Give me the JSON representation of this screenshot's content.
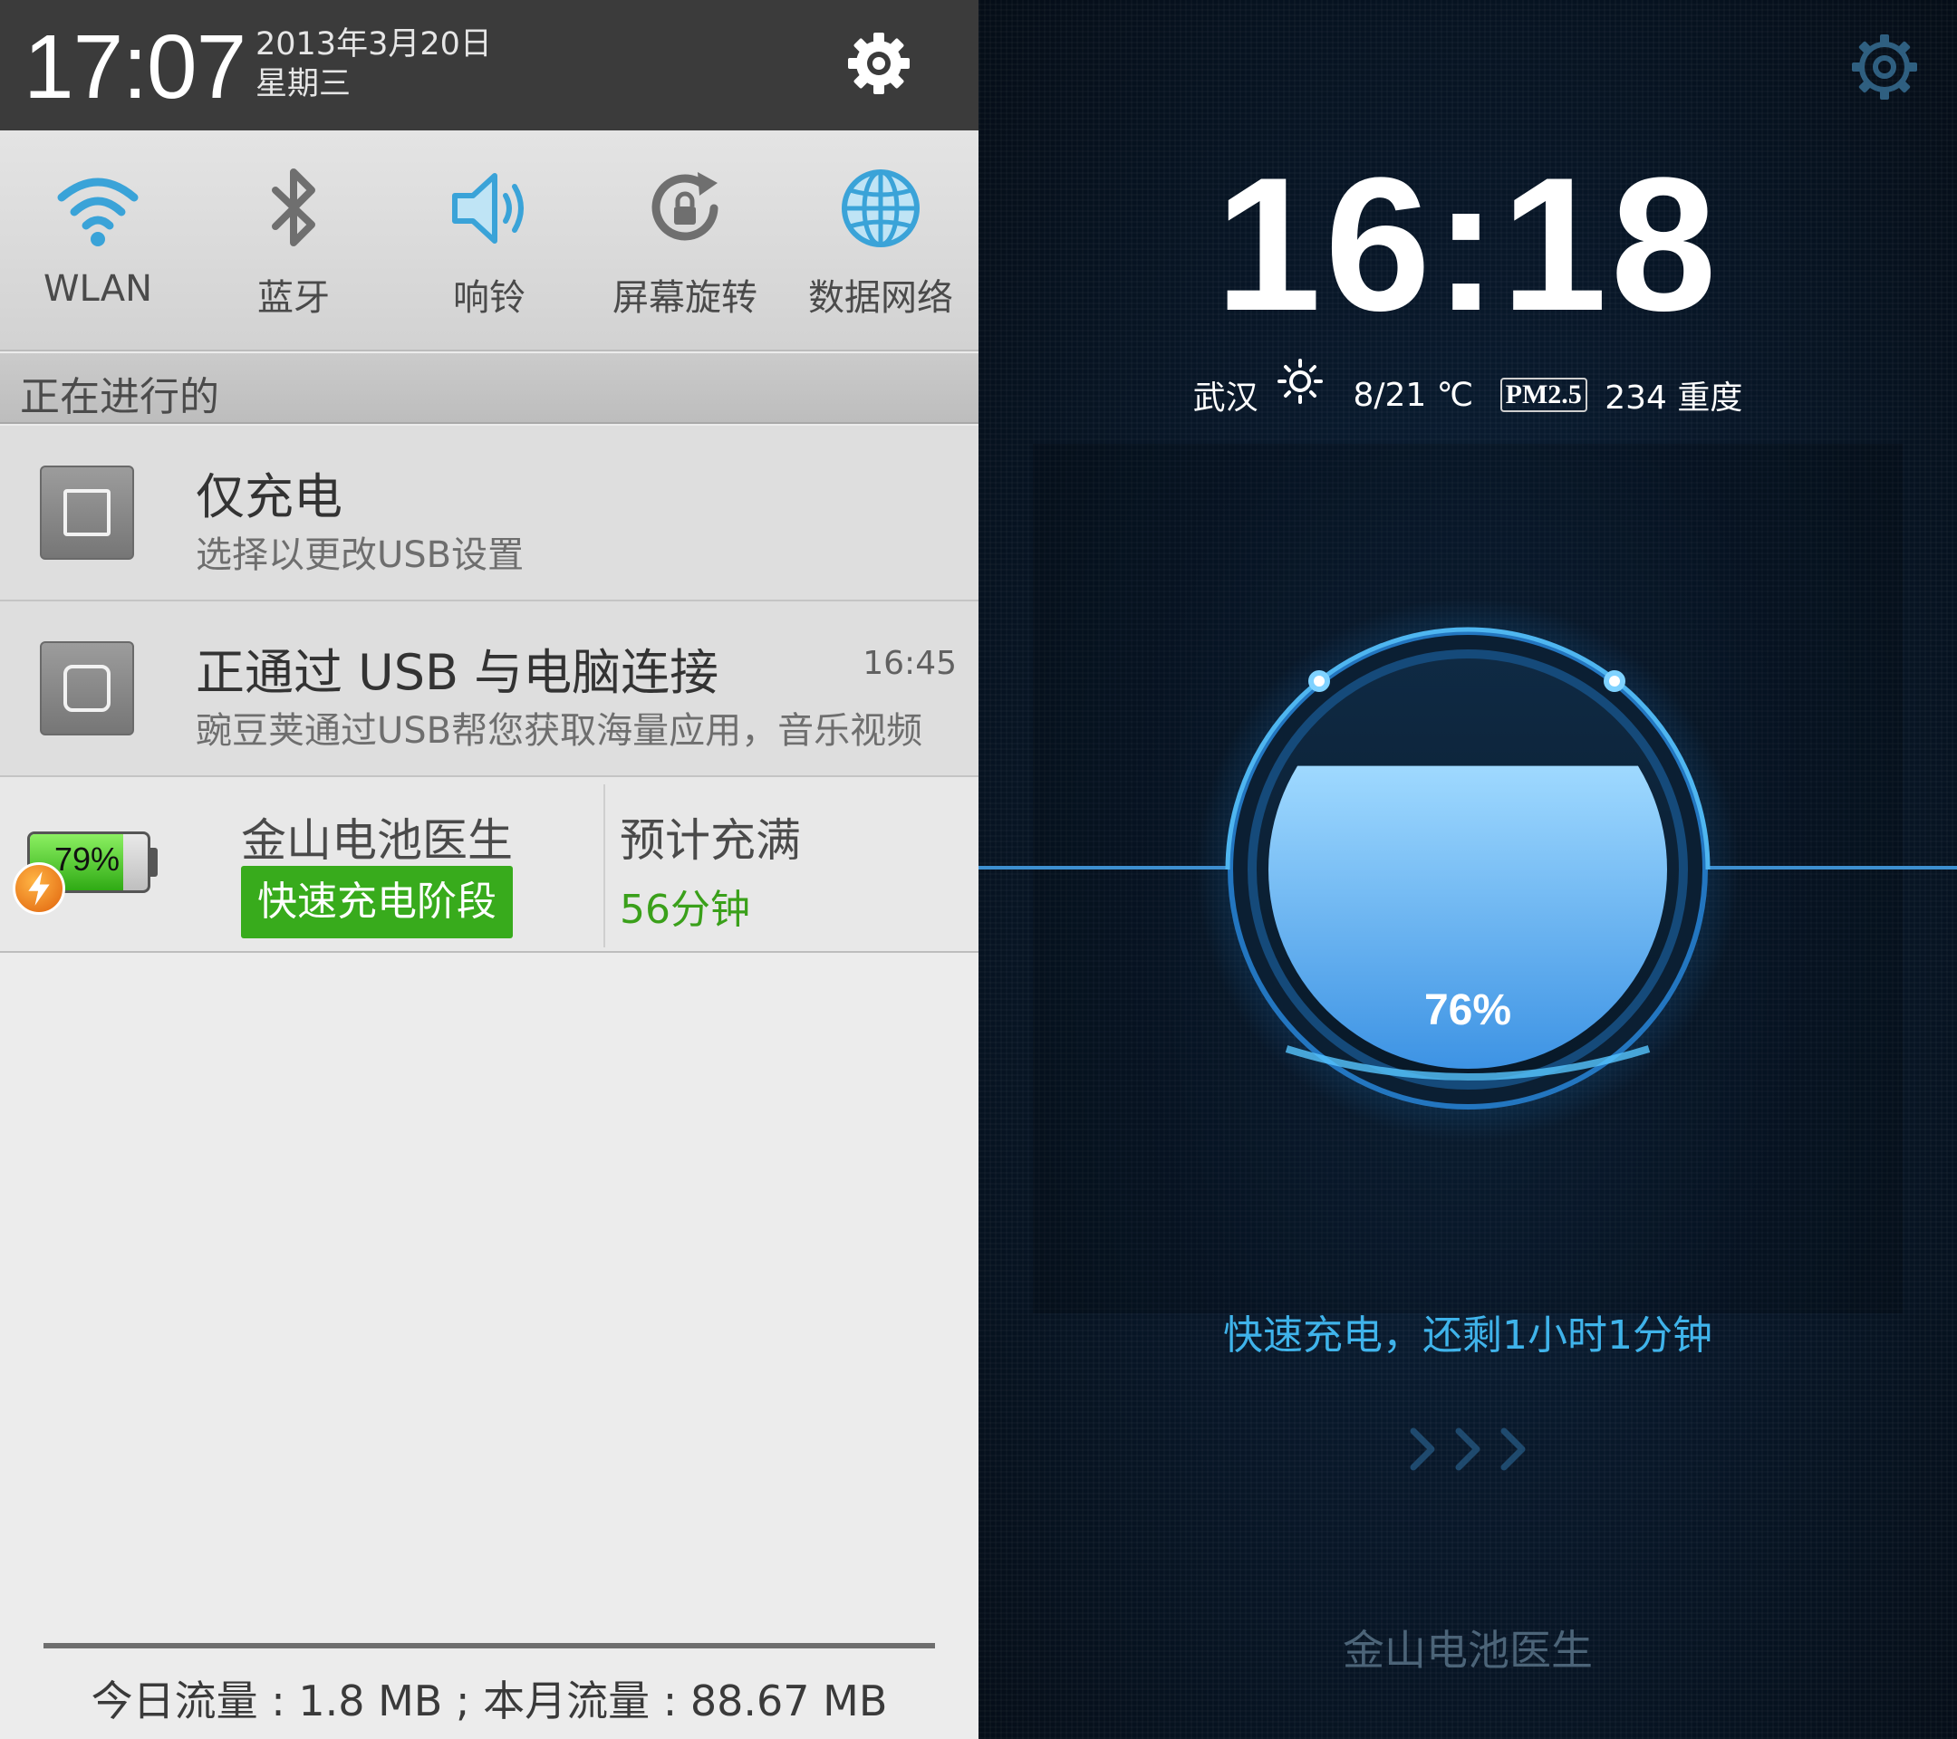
{
  "shade": {
    "time": "17:07",
    "date": "2013年3月20日",
    "weekday": "星期三",
    "settings_icon": "gear-icon"
  },
  "toggles": [
    {
      "label": "WLAN",
      "icon": "wifi-icon",
      "color": "#3aa3d8"
    },
    {
      "label": "蓝牙",
      "icon": "bluetooth-icon",
      "color": "#6f6f6f"
    },
    {
      "label": "响铃",
      "icon": "speaker-icon",
      "color": "#3aa3d8"
    },
    {
      "label": "屏幕旋转",
      "icon": "rotation-lock-icon",
      "color": "#6f6f6f"
    },
    {
      "label": "数据网络",
      "icon": "globe-icon",
      "color": "#3aa3d8"
    }
  ],
  "ongoing": {
    "label": "正在进行的"
  },
  "notifications": [
    {
      "title": "仅充电",
      "subtitle": "选择以更改USB设置",
      "time": "",
      "icon": "usb-settings-icon"
    },
    {
      "title": "正通过 USB 与电脑连接",
      "subtitle": "豌豆荚通过USB帮您获取海量应用，音乐视频",
      "time": "16:45",
      "icon": "wandoujia-icon"
    }
  ],
  "battery_notification": {
    "percent_text": "79%",
    "level": 0.79,
    "app_name": "金山电池医生",
    "stage": "快速充电阶段",
    "estimate_label": "预计充满",
    "estimate_value": "56分钟",
    "accent": "#38ab1c"
  },
  "traffic": {
    "text": "今日流量 : 1.8 MB ; 本月流量 : 88.67 MB"
  },
  "doctor": {
    "clock": "16:18",
    "city": "武汉",
    "weather_icon": "sun-icon",
    "temperature": "8/21 ℃",
    "pm_label": "PM2.5",
    "pm_value": "234 重度",
    "level": 0.76,
    "percent_text": "76%",
    "status": "快速充电，还剩1小时1分钟",
    "brand": "金山电池医生",
    "accent": "#3fb3ea",
    "settings_icon": "gear-icon"
  }
}
